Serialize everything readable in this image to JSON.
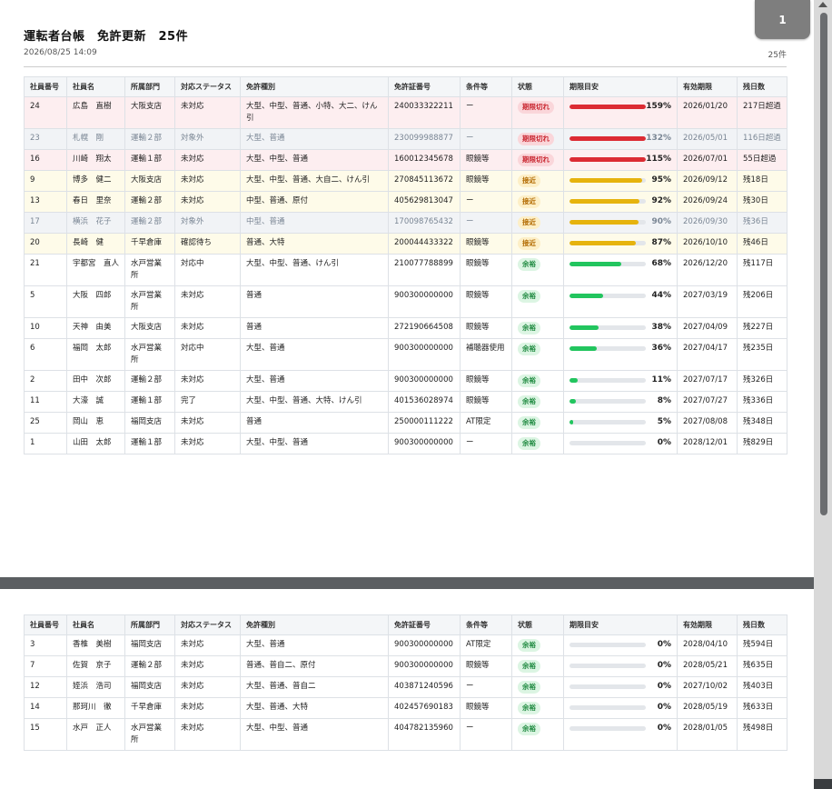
{
  "header": {
    "title": "運転者台帳　免許更新　25件",
    "timestamp": "2026/08/25 14:09",
    "count": "25件",
    "page_number": "1"
  },
  "columns": [
    "社員番号",
    "社員名",
    "所属部門",
    "対応ステータス",
    "免許種別",
    "免許証番号",
    "条件等",
    "状態",
    "期限目安",
    "有効期限",
    "残日数"
  ],
  "colors": {
    "expired": "#dc2b33",
    "near": "#e6b30d",
    "ok": "#22c55e"
  },
  "rows_page1": [
    {
      "id": "24",
      "name": "広島　直樹",
      "dept": "大阪支店",
      "status": "未対応",
      "license": "大型、中型、普通、小特、大二、けん引",
      "number": "240033322211",
      "cond": "ー",
      "state": "期限切れ",
      "state_class": "expired",
      "pct": 159,
      "pct_label": "159%",
      "expiry": "2026/01/20",
      "days": "217日超過"
    },
    {
      "id": "23",
      "name": "札幌　剛",
      "dept": "運輸２部",
      "status": "対象外",
      "license": "大型、普通",
      "number": "230099988877",
      "cond": "ー",
      "state": "期限切れ",
      "state_class": "excluded",
      "badge": "expired",
      "pct": 132,
      "pct_label": "132%",
      "expiry": "2026/05/01",
      "days": "116日超過"
    },
    {
      "id": "16",
      "name": "川崎　翔太",
      "dept": "運輸１部",
      "status": "未対応",
      "license": "大型、中型、普通",
      "number": "160012345678",
      "cond": "眼鏡等",
      "state": "期限切れ",
      "state_class": "expired",
      "pct": 115,
      "pct_label": "115%",
      "expiry": "2026/07/01",
      "days": "55日超過"
    },
    {
      "id": "9",
      "name": "博多　健二",
      "dept": "大阪支店",
      "status": "未対応",
      "license": "大型、中型、普通、大自二、けん引",
      "number": "270845113672",
      "cond": "眼鏡等",
      "state": "接近",
      "state_class": "near",
      "pct": 95,
      "pct_label": "95%",
      "expiry": "2026/09/12",
      "days": "残18日"
    },
    {
      "id": "13",
      "name": "春日　里奈",
      "dept": "運輸２部",
      "status": "未対応",
      "license": "中型、普通、原付",
      "number": "405629813047",
      "cond": "ー",
      "state": "接近",
      "state_class": "near",
      "pct": 92,
      "pct_label": "92%",
      "expiry": "2026/09/24",
      "days": "残30日"
    },
    {
      "id": "17",
      "name": "横浜　花子",
      "dept": "運輸２部",
      "status": "対象外",
      "license": "中型、普通",
      "number": "170098765432",
      "cond": "ー",
      "state": "接近",
      "state_class": "excluded",
      "badge": "near",
      "pct": 90,
      "pct_label": "90%",
      "expiry": "2026/09/30",
      "days": "残36日"
    },
    {
      "id": "20",
      "name": "長崎　健",
      "dept": "千早倉庫",
      "status": "確認待ち",
      "license": "普通、大特",
      "number": "200044433322",
      "cond": "眼鏡等",
      "state": "接近",
      "state_class": "near",
      "pct": 87,
      "pct_label": "87%",
      "expiry": "2026/10/10",
      "days": "残46日"
    },
    {
      "id": "21",
      "name": "宇都宮　直人",
      "dept": "水戸営業所",
      "status": "対応中",
      "license": "大型、中型、普通、けん引",
      "number": "210077788899",
      "cond": "眼鏡等",
      "state": "余裕",
      "state_class": "normal",
      "badge": "ok",
      "pct": 68,
      "pct_label": "68%",
      "expiry": "2026/12/20",
      "days": "残117日"
    },
    {
      "id": "5",
      "name": "大阪　四郎",
      "dept": "水戸営業所",
      "status": "未対応",
      "license": "普通",
      "number": "900300000000",
      "cond": "眼鏡等",
      "state": "余裕",
      "state_class": "normal",
      "badge": "ok",
      "pct": 44,
      "pct_label": "44%",
      "expiry": "2027/03/19",
      "days": "残206日"
    },
    {
      "id": "10",
      "name": "天神　由美",
      "dept": "大阪支店",
      "status": "未対応",
      "license": "普通",
      "number": "272190664508",
      "cond": "眼鏡等",
      "state": "余裕",
      "state_class": "normal",
      "badge": "ok",
      "pct": 38,
      "pct_label": "38%",
      "expiry": "2027/04/09",
      "days": "残227日"
    },
    {
      "id": "6",
      "name": "福岡　太郎",
      "dept": "水戸営業所",
      "status": "対応中",
      "license": "大型、普通",
      "number": "900300000000",
      "cond": "補聴器使用",
      "state": "余裕",
      "state_class": "normal",
      "badge": "ok",
      "pct": 36,
      "pct_label": "36%",
      "expiry": "2027/04/17",
      "days": "残235日"
    },
    {
      "id": "2",
      "name": "田中　次郎",
      "dept": "運輸２部",
      "status": "未対応",
      "license": "大型、普通",
      "number": "900300000000",
      "cond": "眼鏡等",
      "state": "余裕",
      "state_class": "normal",
      "badge": "ok",
      "pct": 11,
      "pct_label": "11%",
      "expiry": "2027/07/17",
      "days": "残326日"
    },
    {
      "id": "11",
      "name": "大濠　誠",
      "dept": "運輸１部",
      "status": "完了",
      "license": "大型、中型、普通、大特、けん引",
      "number": "401536028974",
      "cond": "眼鏡等",
      "state": "余裕",
      "state_class": "normal",
      "badge": "ok",
      "pct": 8,
      "pct_label": "8%",
      "expiry": "2027/07/27",
      "days": "残336日"
    },
    {
      "id": "25",
      "name": "岡山　恵",
      "dept": "福岡支店",
      "status": "未対応",
      "license": "普通",
      "number": "250000111222",
      "cond": "AT限定",
      "state": "余裕",
      "state_class": "normal",
      "badge": "ok",
      "pct": 5,
      "pct_label": "5%",
      "expiry": "2027/08/08",
      "days": "残348日"
    },
    {
      "id": "1",
      "name": "山田　太郎",
      "dept": "運輸１部",
      "status": "未対応",
      "license": "大型、中型、普通",
      "number": "900300000000",
      "cond": "ー",
      "state": "余裕",
      "state_class": "normal",
      "badge": "ok",
      "pct": 0,
      "pct_label": "0%",
      "expiry": "2028/12/01",
      "days": "残829日"
    }
  ],
  "rows_page2": [
    {
      "id": "3",
      "name": "香椎　美樹",
      "dept": "福岡支店",
      "status": "未対応",
      "license": "大型、普通",
      "number": "900300000000",
      "cond": "AT限定",
      "state": "余裕",
      "state_class": "normal",
      "badge": "ok",
      "pct": 0,
      "pct_label": "0%",
      "expiry": "2028/04/10",
      "days": "残594日"
    },
    {
      "id": "7",
      "name": "佐賀　京子",
      "dept": "運輸２部",
      "status": "未対応",
      "license": "普通、普自二、原付",
      "number": "900300000000",
      "cond": "眼鏡等",
      "state": "余裕",
      "state_class": "normal",
      "badge": "ok",
      "pct": 0,
      "pct_label": "0%",
      "expiry": "2028/05/21",
      "days": "残635日"
    },
    {
      "id": "12",
      "name": "姪浜　浩司",
      "dept": "福岡支店",
      "status": "未対応",
      "license": "大型、普通、普自二",
      "number": "403871240596",
      "cond": "ー",
      "state": "余裕",
      "state_class": "normal",
      "badge": "ok",
      "pct": 0,
      "pct_label": "0%",
      "expiry": "2027/10/02",
      "days": "残403日"
    },
    {
      "id": "14",
      "name": "那珂川　徹",
      "dept": "千早倉庫",
      "status": "未対応",
      "license": "大型、普通、大特",
      "number": "402457690183",
      "cond": "眼鏡等",
      "state": "余裕",
      "state_class": "normal",
      "badge": "ok",
      "pct": 0,
      "pct_label": "0%",
      "expiry": "2028/05/19",
      "days": "残633日"
    },
    {
      "id": "15",
      "name": "水戸　正人",
      "dept": "水戸営業所",
      "status": "未対応",
      "license": "大型、中型、普通",
      "number": "404782135960",
      "cond": "ー",
      "state": "余裕",
      "state_class": "normal",
      "badge": "ok",
      "pct": 0,
      "pct_label": "0%",
      "expiry": "2028/01/05",
      "days": "残498日"
    }
  ]
}
